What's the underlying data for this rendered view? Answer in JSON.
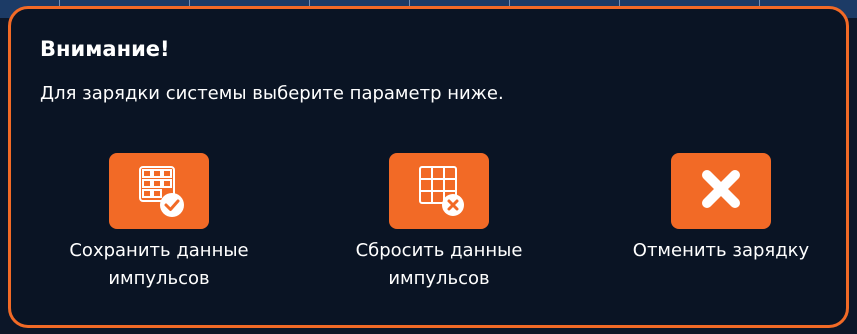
{
  "dialog": {
    "title": "Внимание!",
    "message": "Для зарядки системы выберите параметр ниже."
  },
  "options": [
    {
      "label": "Сохранить данные импульсов",
      "icon": "grid-check-icon"
    },
    {
      "label": "Сбросить данные импульсов",
      "icon": "grid-x-icon"
    },
    {
      "label": "Отменить зарядку",
      "icon": "close-icon"
    }
  ],
  "colors": {
    "accent": "#f26a26",
    "dialog_bg": "#0a1424",
    "text": "#ffffff"
  }
}
